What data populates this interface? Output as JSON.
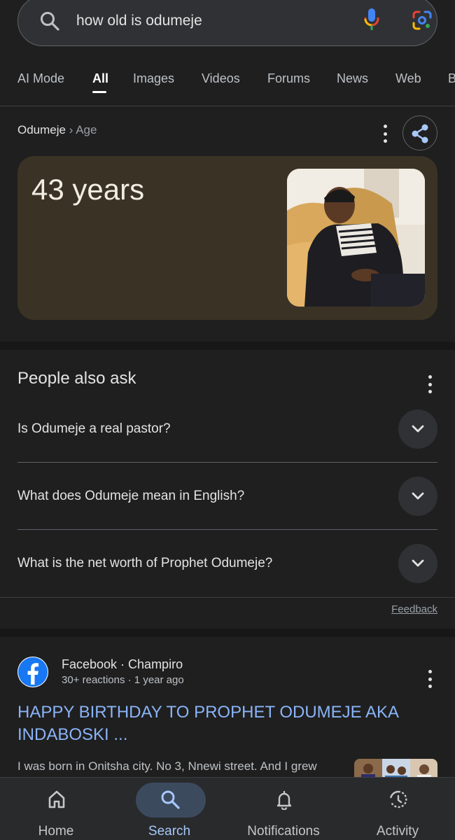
{
  "search": {
    "query": "how old is odumeje",
    "icons": [
      "search-icon",
      "mic-icon",
      "lens-icon"
    ]
  },
  "tabs": [
    {
      "label": "AI Mode"
    },
    {
      "label": "All",
      "active": true
    },
    {
      "label": "Images"
    },
    {
      "label": "Videos"
    },
    {
      "label": "Forums"
    },
    {
      "label": "News"
    },
    {
      "label": "Web"
    },
    {
      "label": "B"
    }
  ],
  "answer": {
    "breadcrumb_entity": "Odumeje",
    "breadcrumb_sep": "›",
    "breadcrumb_attr": "Age",
    "value": "43 years"
  },
  "people_also_ask": {
    "title": "People also ask",
    "questions": [
      "Is Odumeje a real pastor?",
      "What does Odumeje mean in English?",
      "What is the net worth of Prophet Odumeje?"
    ],
    "feedback": "Feedback"
  },
  "result": {
    "source": "Facebook · Champiro",
    "meta": "30+ reactions · 1 year ago",
    "title": "HAPPY BIRTHDAY TO PROPHET ODUMEJE AKA INDABOSKI ...",
    "snippet": "I was born in Onitsha city. No 3, Nnewi street. And I grew"
  },
  "bottom_nav": [
    {
      "label": "Home",
      "icon": "home-icon"
    },
    {
      "label": "Search",
      "icon": "search-icon",
      "active": true
    },
    {
      "label": "Notifications",
      "icon": "bell-icon"
    },
    {
      "label": "Activity",
      "icon": "history-icon"
    }
  ],
  "colors": {
    "accent": "#8ab4f8",
    "answer_card": "#3a3325",
    "background": "#1f1f1f"
  }
}
